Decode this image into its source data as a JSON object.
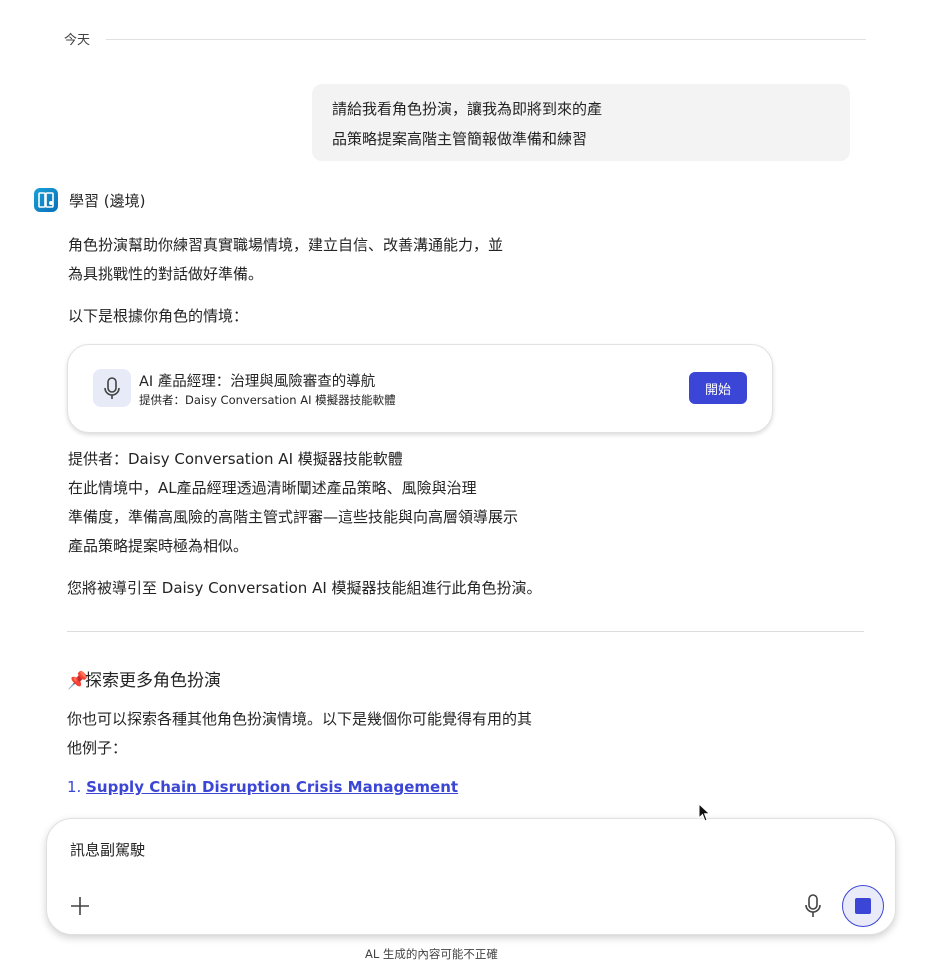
{
  "conversation": {
    "date_divider": "今天",
    "user_message": {
      "line1": "請給我看角色扮演，讓我為即將到來的產",
      "line2": "品策略提案高階主管簡報做準備和練習"
    },
    "assistant": {
      "name": "學習 (邊境)",
      "intro_line1": "角色扮演幫助你練習真實職場情境，建立自信、改善溝通能力，並",
      "intro_line2": "為具挑戰性的對話做好準備。",
      "scenario_lead": "以下是根據你角色的情境："
    },
    "scenario_card": {
      "title": "AI 產品經理：治理與風險審查的導航",
      "provider": "提供者：Daisy Conversation AI 模擬器技能軟體",
      "start_label": "開始",
      "mic_icon": "mic-icon"
    },
    "details": {
      "provider": "提供者：Daisy Conversation AI 模擬器技能軟體",
      "desc_line1": "在此情境中，AL產品經理透過清晰闡述產品策略、風險與治理",
      "desc_line2": "準備度，準備高風險的高階主管式評審—這些技能與向高層領導展示",
      "desc_line3": "產品策略提案時極為相似。",
      "redirect": "您將被導引至 Daisy Conversation AI 模擬器技能組進行此角色扮演。"
    },
    "explore": {
      "pin_icon": "📌",
      "heading": "探索更多角色扮演",
      "intro_line1": "你也可以探索各種其他角色扮演情境。以下是幾個你可能覺得有用的其",
      "intro_line2": "他例子：",
      "items": [
        {
          "number": "1.",
          "label": "Supply Chain Disruption Crisis Management"
        }
      ]
    }
  },
  "composer": {
    "placeholder": "訊息副駕駛",
    "plus_icon": "plus-icon",
    "mic_icon": "mic-icon",
    "stop_icon": "stop-icon"
  },
  "footer": {
    "disclaimer": "AL 生成的內容可能不正確"
  },
  "colors": {
    "accent": "#3b46d6",
    "bubble_bg": "#f3f3f3",
    "app_icon": "#0b6fb8"
  }
}
